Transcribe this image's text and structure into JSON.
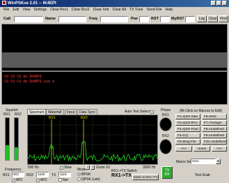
{
  "app": {
    "title": "WinPSKse 2.01 -- IK4EPI"
  },
  "menu": [
    "File",
    "Edit",
    "View",
    "Settings",
    "Clear Rcv1",
    "Clear Rcv2",
    "Clear Xmt",
    "Clear All",
    "TX Tune",
    "Send File",
    "Help"
  ],
  "callbar": {
    "call_label": "Call",
    "name_label": "Name",
    "freq_label": "Freq",
    "pwr_label": "Pwr",
    "rst_label": "RST",
    "myrst_label": "MyRST",
    "call_value": "",
    "name_value": "",
    "freq_value": "",
    "pwr_value": "",
    "rst_value": "",
    "myrst_value": "",
    "log_button": "Log",
    "clear_button": "Clear",
    "find_button": "Find"
  },
  "tx_text": [
    "CQ CQ CQ de IK4EPI",
    "CQ CQ CQ de IK4EPI pse k"
  ],
  "squelch": {
    "label": "Squelch",
    "rx1": "RX1",
    "rx2": "RX2"
  },
  "tabs": [
    "Spectrum",
    "Waterfall",
    "Input",
    "Data Sync"
  ],
  "auto_text_select": {
    "label": "Auto Text Select",
    "checked": true
  },
  "phase": {
    "label": "Phase",
    "rx1": "RX1",
    "rx2": "RX2"
  },
  "spectrum": {
    "rx1_marker": "RX1",
    "rx2_marker": "RX2",
    "freq_low": "500 Hz",
    "freq_high": "3500 Hz",
    "slow_label": "Slow",
    "slow_checked": true,
    "zoom_label": "Zoom X1"
  },
  "frequency": {
    "label": "Frequency",
    "rx1_label": "RX1",
    "rx1_value": "903",
    "rx2_label": "RX2",
    "rx2_value": "1645",
    "tx_label": "TX",
    "tx_value": "1118",
    "afc1_label": "AFC",
    "afc2_label": "AFC",
    "net_label": "Net"
  },
  "mode": {
    "label": "Mode",
    "bpsk": "BPSK",
    "qpsk": "QPSK (usb)",
    "selected": "BPSK"
  },
  "switch": {
    "label": "RX1->TX Switch",
    "value": "RX1->TX",
    "button": "Switch to RX2->TX",
    "tx_button": "TX\nRX"
  },
  "macros": {
    "header": "(Rt-Click on Macros to Edit)",
    "buttons": [
      "F1=QSO Start",
      "F2=QSO BTU",
      "F3=QSO Final",
      "F4=CQ",
      "F5=Brag File",
      "F6=RSG",
      "F7=Tnxlogin",
      "F8=Undefined",
      "F9=Undefined",
      "F10=Undefined"
    ],
    "prev_label": "<<<",
    "home_label": "Home",
    "next_label": ">>>",
    "set_label": "Macro Set",
    "set_value": "Set1",
    "grab_label": "Text Grab"
  },
  "colors": {
    "tx_text": "#ff4040",
    "marker": "#e0e000",
    "spectrum": "#20e020",
    "tx_button": "#2fa82f"
  }
}
